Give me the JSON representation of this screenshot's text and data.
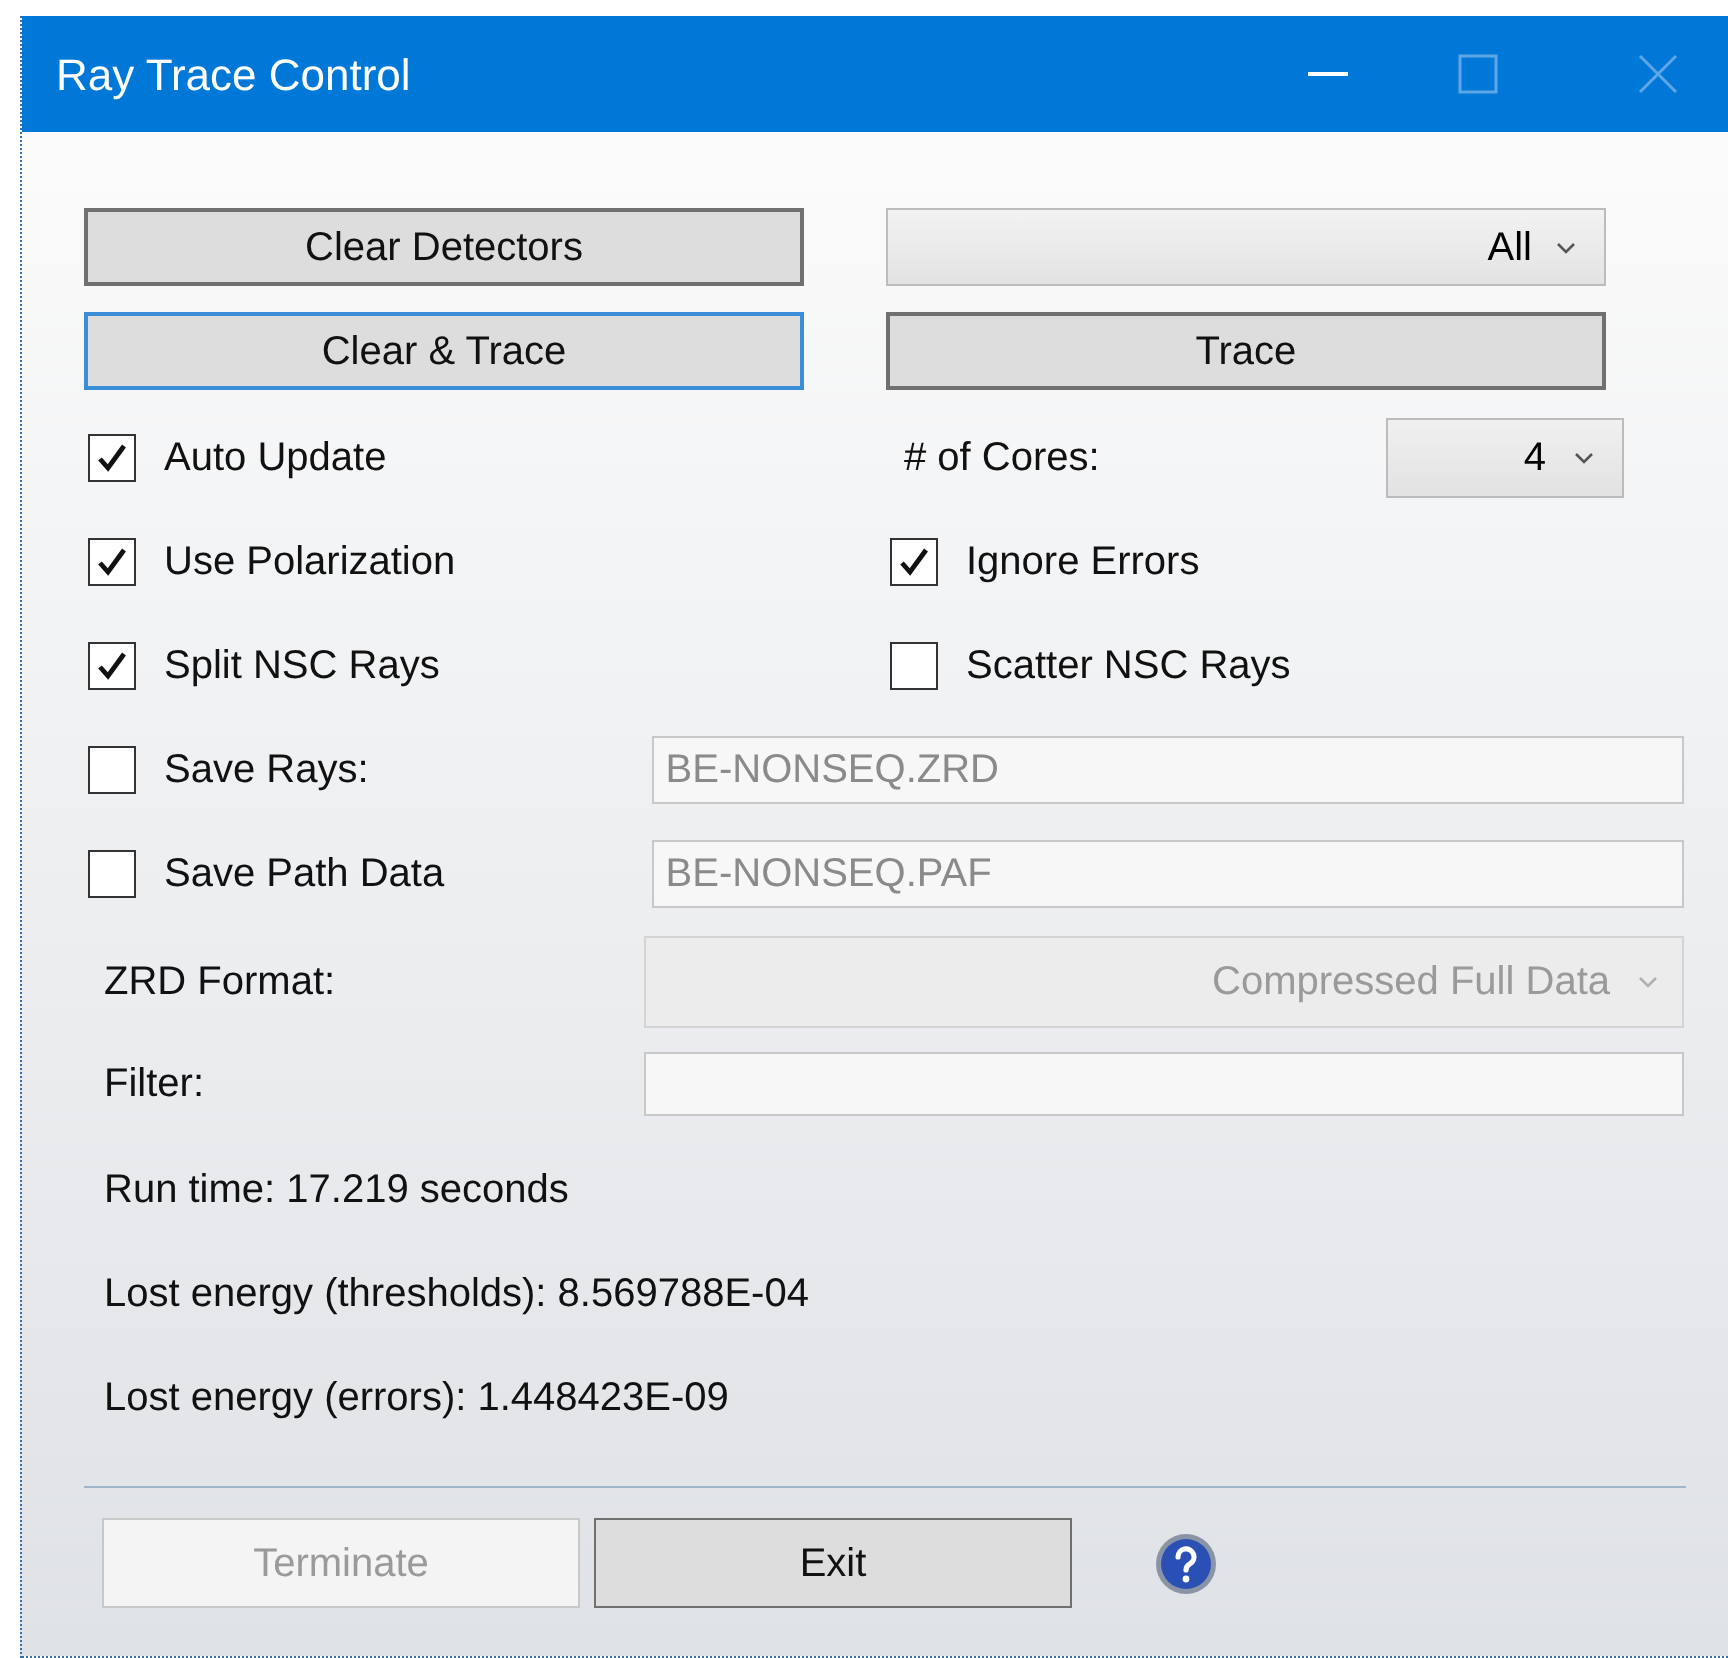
{
  "window": {
    "title": "Ray Trace Control"
  },
  "top_buttons": [
    {
      "label": "Clear Detectors",
      "focused": false
    },
    {
      "label": "Clear & Trace",
      "focused": true
    },
    {
      "label": "Trace",
      "focused": false
    }
  ],
  "detector_select": {
    "value": "All"
  },
  "left_options": [
    {
      "label": "Auto Update",
      "checked": true
    },
    {
      "label": "Use Polarization",
      "checked": true
    },
    {
      "label": "Split NSC Rays",
      "checked": true
    }
  ],
  "cores": {
    "label": "# of Cores:",
    "value": "4"
  },
  "right_options": [
    {
      "label": "Ignore Errors",
      "checked": true
    },
    {
      "label": "Scatter NSC Rays",
      "checked": false
    }
  ],
  "save_rows": [
    {
      "label": "Save Rays:",
      "checked": false,
      "value": "BE-NONSEQ.ZRD"
    },
    {
      "label": "Save Path Data",
      "checked": false,
      "value": "BE-NONSEQ.PAF"
    }
  ],
  "zrd_format": {
    "label": "ZRD Format:",
    "value": "Compressed Full Data",
    "disabled": true
  },
  "filter": {
    "label": "Filter:"
  },
  "results": [
    "Run time: 17.219 seconds",
    "Lost energy (thresholds): 8.569788E-04",
    "Lost energy (errors): 1.448423E-09"
  ],
  "footer_buttons": [
    {
      "label": "Terminate",
      "disabled": true
    },
    {
      "label": "Exit",
      "disabled": false
    }
  ]
}
